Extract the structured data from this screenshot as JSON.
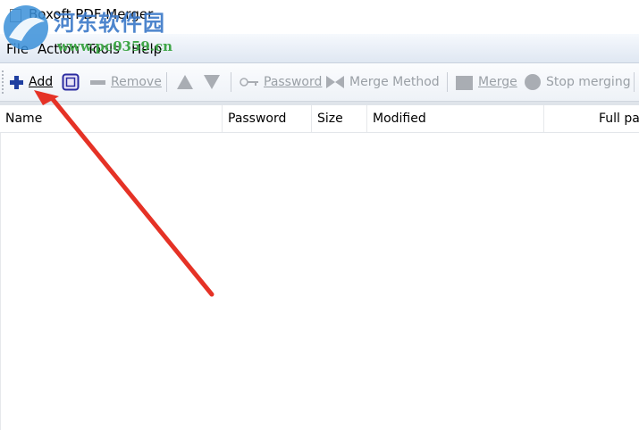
{
  "window": {
    "title": "Boxoft PDF Merger"
  },
  "watermark": {
    "line1": "河东软件园",
    "line2": "www.pc0359.cn"
  },
  "menu": [
    {
      "label": "File"
    },
    {
      "label": "Action"
    },
    {
      "label": "Tools"
    },
    {
      "label": "Help"
    }
  ],
  "toolbar": {
    "add": "Add",
    "remove": "Remove",
    "password": "Password",
    "merge_method": "Merge Method",
    "merge": "Merge",
    "stop_merging": "Stop merging"
  },
  "columns": [
    "Name",
    "Password",
    "Size",
    "Modified",
    "Full path"
  ],
  "rows": [],
  "colors": {
    "accent": "#1f3fa0",
    "annotation_arrow": "#e53226"
  }
}
